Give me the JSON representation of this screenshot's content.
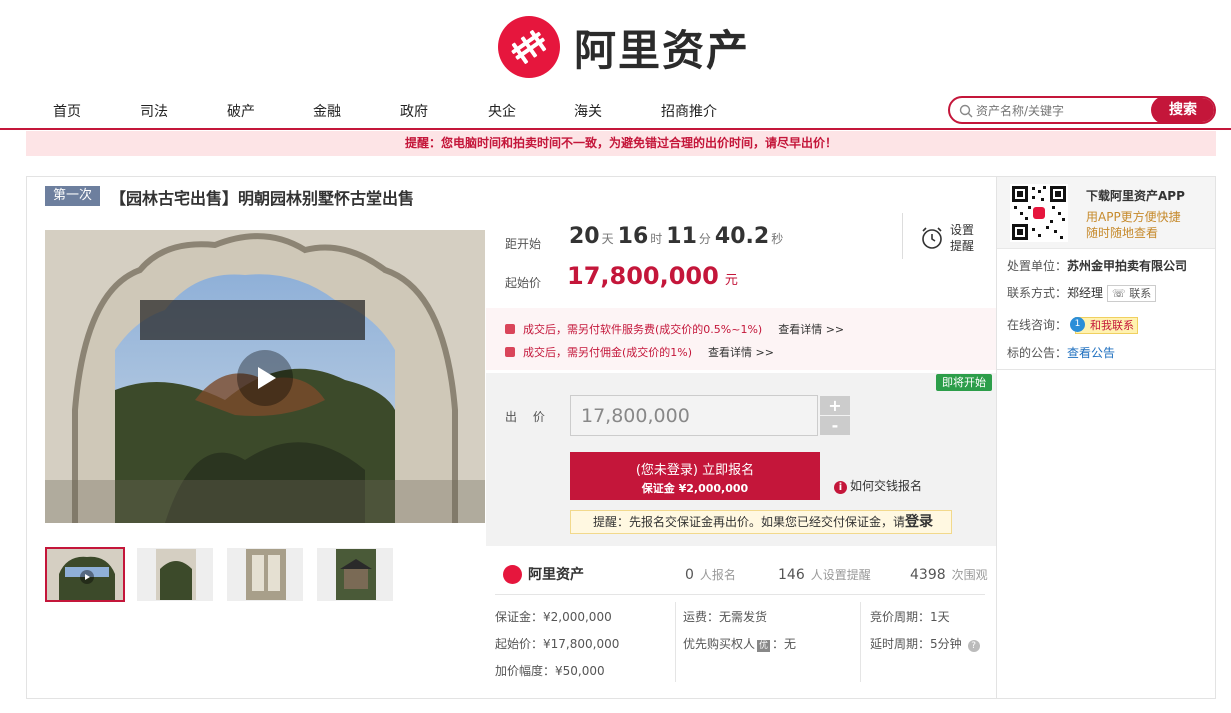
{
  "brand": {
    "name": "阿里资产",
    "accent": "#c4163a",
    "logo_red": "#e6163d"
  },
  "nav": {
    "items": [
      "首页",
      "司法",
      "破产",
      "金融",
      "政府",
      "央企",
      "海关",
      "招商推介"
    ]
  },
  "search": {
    "placeholder": "资产名称/关键字",
    "button": "搜索",
    "icon": "search-icon"
  },
  "notice": "提醒：您电脑时间和拍卖时间不一致，为避免错过合理的出价时间，请尽早出价！",
  "item": {
    "round_tag": "第一次",
    "title": "【园林古宅出售】明朝园林别墅怀古堂出售"
  },
  "countdown": {
    "label": "距开始",
    "days": "20",
    "days_unit": "天",
    "hours": "16",
    "hours_unit": "时",
    "minutes": "11",
    "minutes_unit": "分",
    "seconds": "40.2",
    "seconds_unit": "秒"
  },
  "remind": {
    "line1": "设置",
    "line2": "提醒",
    "icon": "alarm-clock-icon"
  },
  "start_price": {
    "label": "起始价",
    "value": "17,800,000",
    "unit": "元"
  },
  "fees": [
    {
      "text": "成交后，需另付软件服务费(成交价的0.5%~1%)",
      "link": "查看详情 >>"
    },
    {
      "text": "成交后，需另付佣金(成交价的1%)",
      "link": "查看详情 >>"
    }
  ],
  "bid": {
    "status_badge": "即将开始",
    "label": "出 价",
    "value": "17,800,000",
    "plus": "+",
    "minus": "-",
    "signup_line1": "(您未登录) 立即报名",
    "signup_line2": "保证金 ¥2,000,000",
    "how_to_pay": "如何交钱报名",
    "tip_text": "提醒：先报名交保证金再出价。如果您已经交付保证金，请",
    "tip_login": "登录"
  },
  "stats": {
    "brand": "阿里资产",
    "signups": "0",
    "signups_label": "人报名",
    "reminders": "146",
    "reminders_label": "人设置提醒",
    "views": "4398",
    "views_label": "次围观"
  },
  "info": {
    "deposit": "保证金：¥2,000,000",
    "start_price": "起始价：¥17,800,000",
    "increment": "加价幅度：¥50,000",
    "shipping": "运费：无需发货",
    "priority_buyer_label": "优先购买权人",
    "priority_buyer_tag": "优",
    "priority_buyer_value": "：无",
    "bid_cycle": "竞价周期：1天",
    "delay_cycle": "延时周期：5分钟"
  },
  "sidebar": {
    "app_title": "下载阿里资产APP",
    "app_line1": "用APP更方便快捷",
    "app_line2": "随时随地查看",
    "org_label": "处置单位：",
    "org_value": "苏州金甲拍卖有限公司",
    "contact_label": "联系方式：",
    "contact_name": "郑经理",
    "contact_btn": "联系",
    "chat_label": "在线咨询：",
    "chat_btn": "和我联系",
    "chat_count": "1",
    "notice_label": "标的公告：",
    "notice_link": "查看公告"
  }
}
